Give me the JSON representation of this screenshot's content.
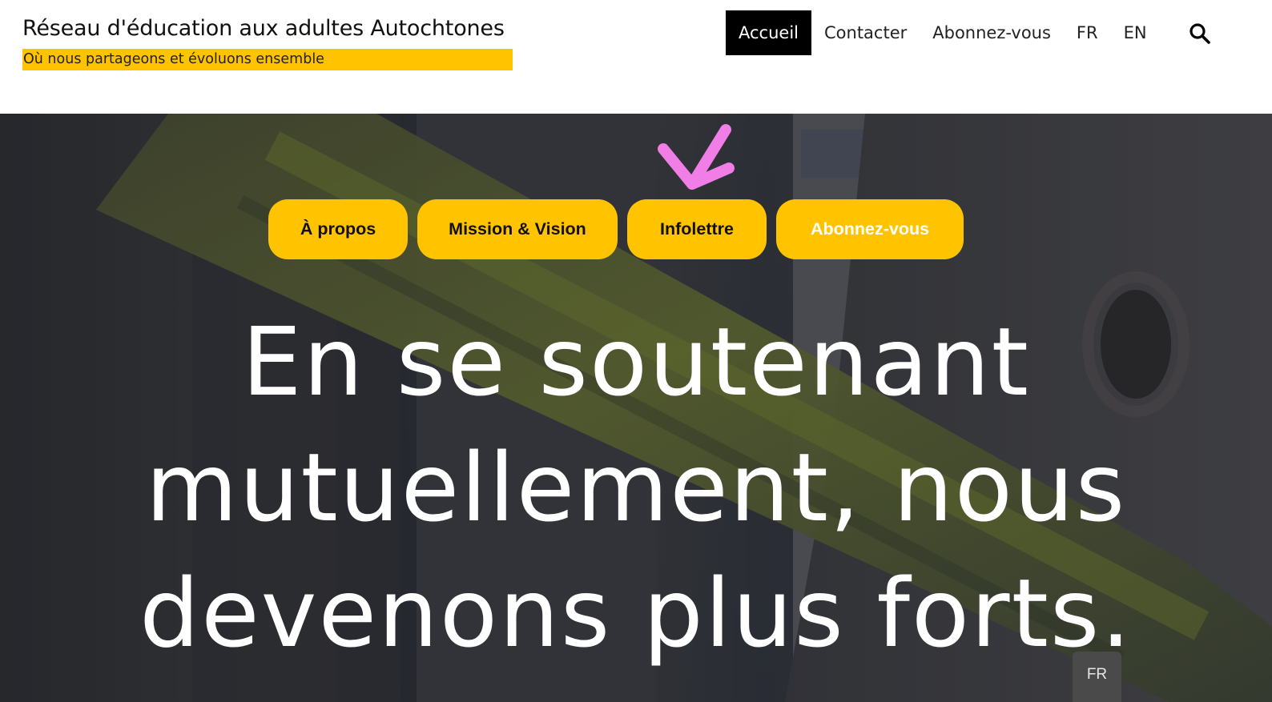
{
  "header": {
    "site_title": "Réseau d'éducation aux adultes Autochtones",
    "tagline": "Où nous partageons et évoluons ensemble",
    "accent_color": "#ffc300",
    "nav": {
      "items": [
        {
          "label": "Accueil",
          "active": true
        },
        {
          "label": "Contacter"
        },
        {
          "label": "Abonnez-vous"
        },
        {
          "label": "FR"
        },
        {
          "label": "EN"
        }
      ],
      "search_icon": "search-icon"
    }
  },
  "hero": {
    "buttons": [
      {
        "label": "À propos"
      },
      {
        "label": "Mission & Vision"
      },
      {
        "label": "Infolettre"
      },
      {
        "label": "Abonnez-vous"
      }
    ],
    "heading_lines": [
      "En se soutenant",
      "mutuellement, nous",
      "devenons plus forts."
    ],
    "annotation_icon": "checkmark-icon",
    "annotation_color": "#f07ee6",
    "language_chip": "FR"
  }
}
